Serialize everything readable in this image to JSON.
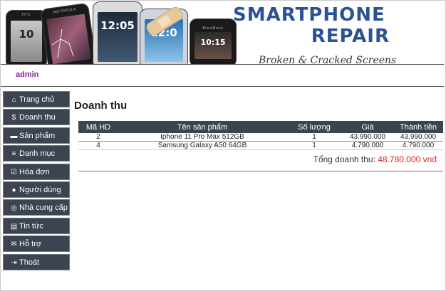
{
  "banner": {
    "title_line1": "SMARTPHONE",
    "title_line2": "REPAIR",
    "subtitle": "Broken & Cracked Screens",
    "phone_labels": [
      "HTC",
      "MOTOROLA",
      "",
      "",
      "BlackBerry"
    ],
    "phone_clocks": [
      "10",
      "",
      "12:05",
      "12:0",
      "10:15"
    ]
  },
  "user": {
    "name": "admin"
  },
  "sidebar": {
    "items": [
      {
        "label": "Trang chủ",
        "icon": "home-icon",
        "glyph": "⌂"
      },
      {
        "label": "Doanh thu",
        "icon": "dollar-icon",
        "glyph": "$"
      },
      {
        "label": "Sản phẩm",
        "icon": "box-icon",
        "glyph": "▬"
      },
      {
        "label": "Danh mục",
        "icon": "list-icon",
        "glyph": "≡"
      },
      {
        "label": "Hóa đơn",
        "icon": "calendar-check-icon",
        "glyph": "☑"
      },
      {
        "label": "Người dùng",
        "icon": "user-icon",
        "glyph": "●"
      },
      {
        "label": "Nhà cung cấp",
        "icon": "handshake-icon",
        "glyph": "◎"
      },
      {
        "label": "Tin tức",
        "icon": "newspaper-icon",
        "glyph": "▤"
      },
      {
        "label": "Hỗ trợ",
        "icon": "envelope-icon",
        "glyph": "✉"
      },
      {
        "label": "Thoát",
        "icon": "sign-out-icon",
        "glyph": "⇥"
      }
    ]
  },
  "main": {
    "title": "Doanh thu",
    "table": {
      "headers": [
        "Mã HD",
        "Tên sản phẩm",
        "Số lượng",
        "Giá",
        "Thành tiền"
      ],
      "rows": [
        [
          "2",
          "Iphone 11 Pro Max 512GB",
          "1",
          "43.990.000",
          "43.990.000"
        ],
        [
          "4",
          "Samsung Galaxy A50 64GB",
          "1",
          "4.790.000",
          "4.790.000"
        ]
      ]
    },
    "total_label": "Tổng doanh thu:",
    "total_value": "48.780.000 vnđ"
  },
  "colors": {
    "nav_bg": "#3b4450",
    "title_blue": "#2b5297",
    "admin": "#8b1fa8",
    "total": "#e0201d"
  }
}
